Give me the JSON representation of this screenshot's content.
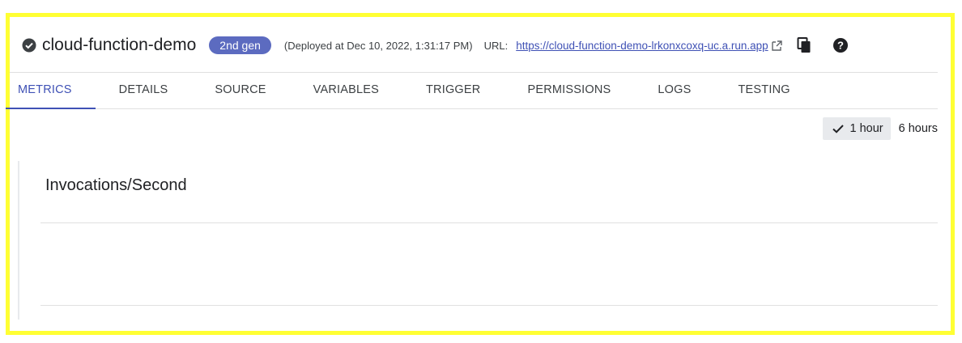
{
  "header": {
    "title": "cloud-function-demo",
    "status_icon": "check-circle-icon",
    "badge": "2nd gen",
    "deployed_text": "(Deployed at Dec 10, 2022, 1:31:17 PM)",
    "url_label": "URL:",
    "url": "https://cloud-function-demo-lrkonxcoxq-uc.a.run.app",
    "external_icon": "open-in-new-icon",
    "copy_icon": "copy-icon",
    "help_icon": "help-icon"
  },
  "tabs": [
    {
      "label": "METRICS",
      "active": true
    },
    {
      "label": "DETAILS"
    },
    {
      "label": "SOURCE"
    },
    {
      "label": "VARIABLES"
    },
    {
      "label": "TRIGGER"
    },
    {
      "label": "PERMISSIONS"
    },
    {
      "label": "LOGS"
    },
    {
      "label": "TESTING"
    }
  ],
  "time_range": {
    "selected": "1 hour",
    "other": "6 hours"
  },
  "chart": {
    "title": "Invocations/Second"
  },
  "colors": {
    "accent": "#3f51b5",
    "badge": "#5c6bc0",
    "highlight_border": "#ffff33"
  }
}
